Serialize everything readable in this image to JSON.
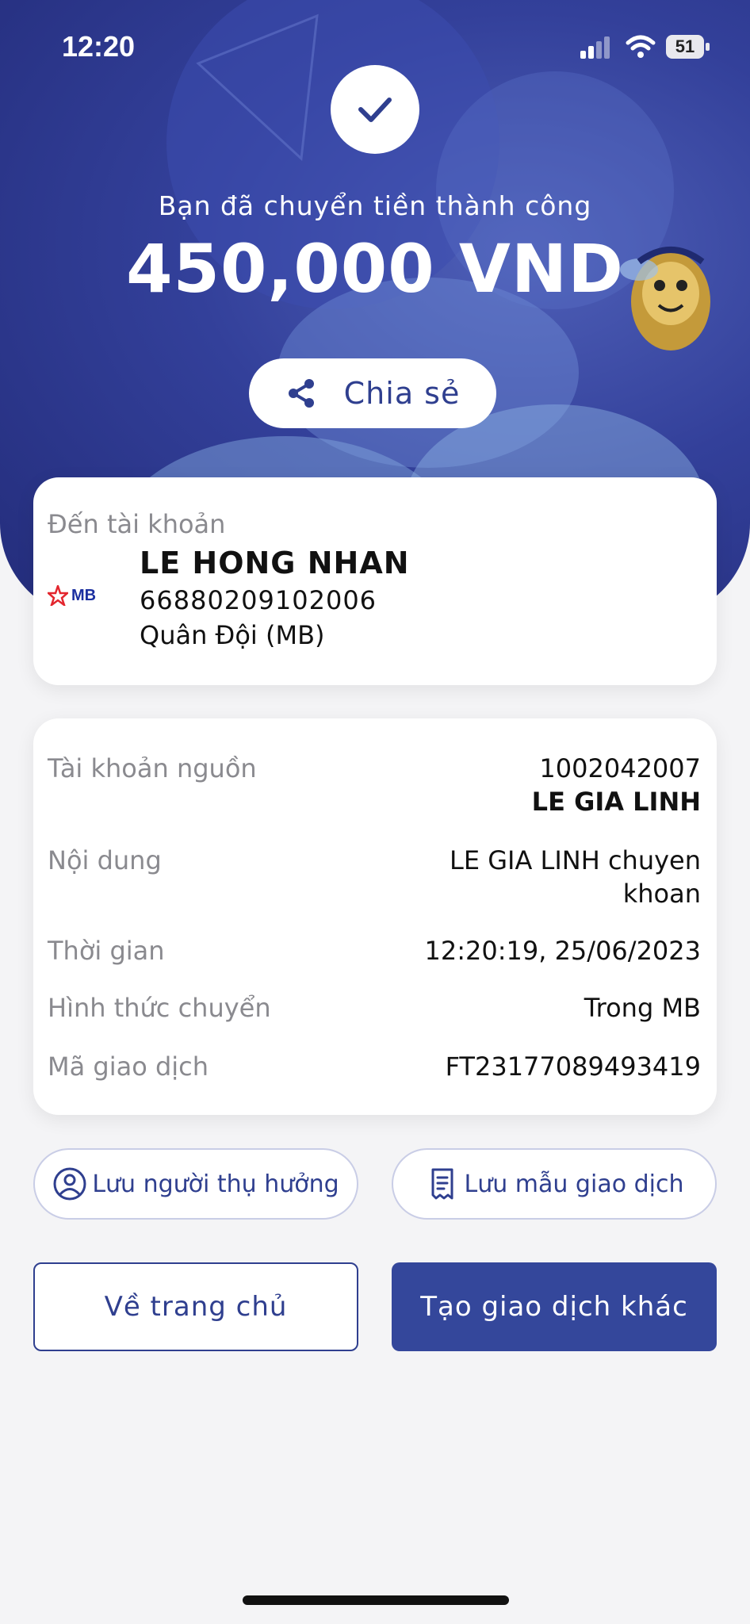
{
  "status_bar": {
    "time": "12:20",
    "battery": "51"
  },
  "header": {
    "success_message": "Bạn đã chuyển tiền thành công",
    "amount": "450,000 VND",
    "share_label": "Chia sẻ"
  },
  "recipient": {
    "label": "Đến tài khoản",
    "bank_logo_text": "MB",
    "name": "LE HONG NHAN",
    "account_number": "66880209102006",
    "bank_name": "Quân Đội (MB)"
  },
  "details": {
    "source_label": "Tài khoản nguồn",
    "source_account": "1002042007",
    "source_name": "LE GIA LINH",
    "content_label": "Nội dung",
    "content_line1": "LE GIA LINH chuyen",
    "content_line2": "khoan",
    "time_label": "Thời gian",
    "time_value": "12:20:19, 25/06/2023",
    "method_label": "Hình thức chuyển",
    "method_value": "Trong MB",
    "txn_label": "Mã giao dịch",
    "txn_value": "FT23177089493419"
  },
  "actions": {
    "save_beneficiary": "Lưu người thụ hưởng",
    "save_template": "Lưu mẫu giao dịch",
    "home": "Về trang chủ",
    "new_transaction": "Tạo giao dịch khác"
  },
  "colors": {
    "brand": "#34479b",
    "hero": "#33409a",
    "background": "#f4f4f6"
  }
}
